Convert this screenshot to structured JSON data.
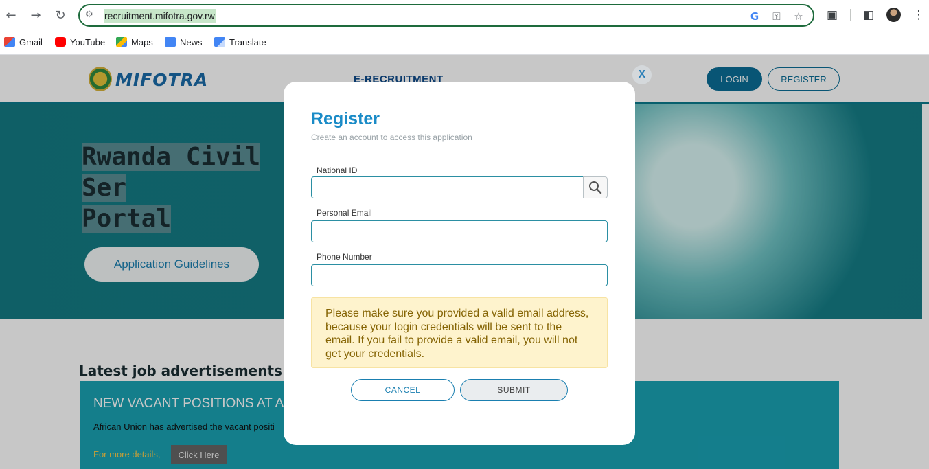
{
  "browser": {
    "url": "recruitment.mifotra.gov.rw",
    "bookmarks": [
      {
        "label": "Gmail",
        "icon": "gmail-icon"
      },
      {
        "label": "YouTube",
        "icon": "youtube-icon"
      },
      {
        "label": "Maps",
        "icon": "maps-icon"
      },
      {
        "label": "News",
        "icon": "news-icon"
      },
      {
        "label": "Translate",
        "icon": "translate-icon"
      }
    ]
  },
  "site": {
    "logo_text": "MIFOTRA",
    "nav_item": "E-RECRUITMENT",
    "login_label": "LOGIN",
    "register_label": "REGISTER",
    "hero_title_line1": "Rwanda Civil Ser",
    "hero_title_line2": "Portal",
    "guidelines_label": "Application Guidelines",
    "latest_title": "Latest job advertisements",
    "job": {
      "title": "NEW VACANT POSITIONS AT A",
      "description": "African Union has advertised the vacant positi",
      "more_details": "For more details,",
      "click_here": "Click Here"
    }
  },
  "modal": {
    "close_label": "X",
    "title": "Register",
    "subtitle": "Create an account to access this application",
    "fields": {
      "national_id": {
        "label": "National ID",
        "value": "",
        "placeholder": ""
      },
      "email": {
        "label": "Personal Email",
        "value": "",
        "placeholder": ""
      },
      "phone": {
        "label": "Phone Number",
        "value": "",
        "placeholder": ""
      }
    },
    "notice": "Please make sure you provided a valid email address, because your login credentials will be sent to the email. If you fail to provide a valid email, you will not get your credentials.",
    "cancel_label": "CANCEL",
    "submit_label": "SUBMIT"
  },
  "colors": {
    "accent": "#1a8bc7",
    "hero": "#147a83",
    "notice_bg": "#fef3cd"
  }
}
